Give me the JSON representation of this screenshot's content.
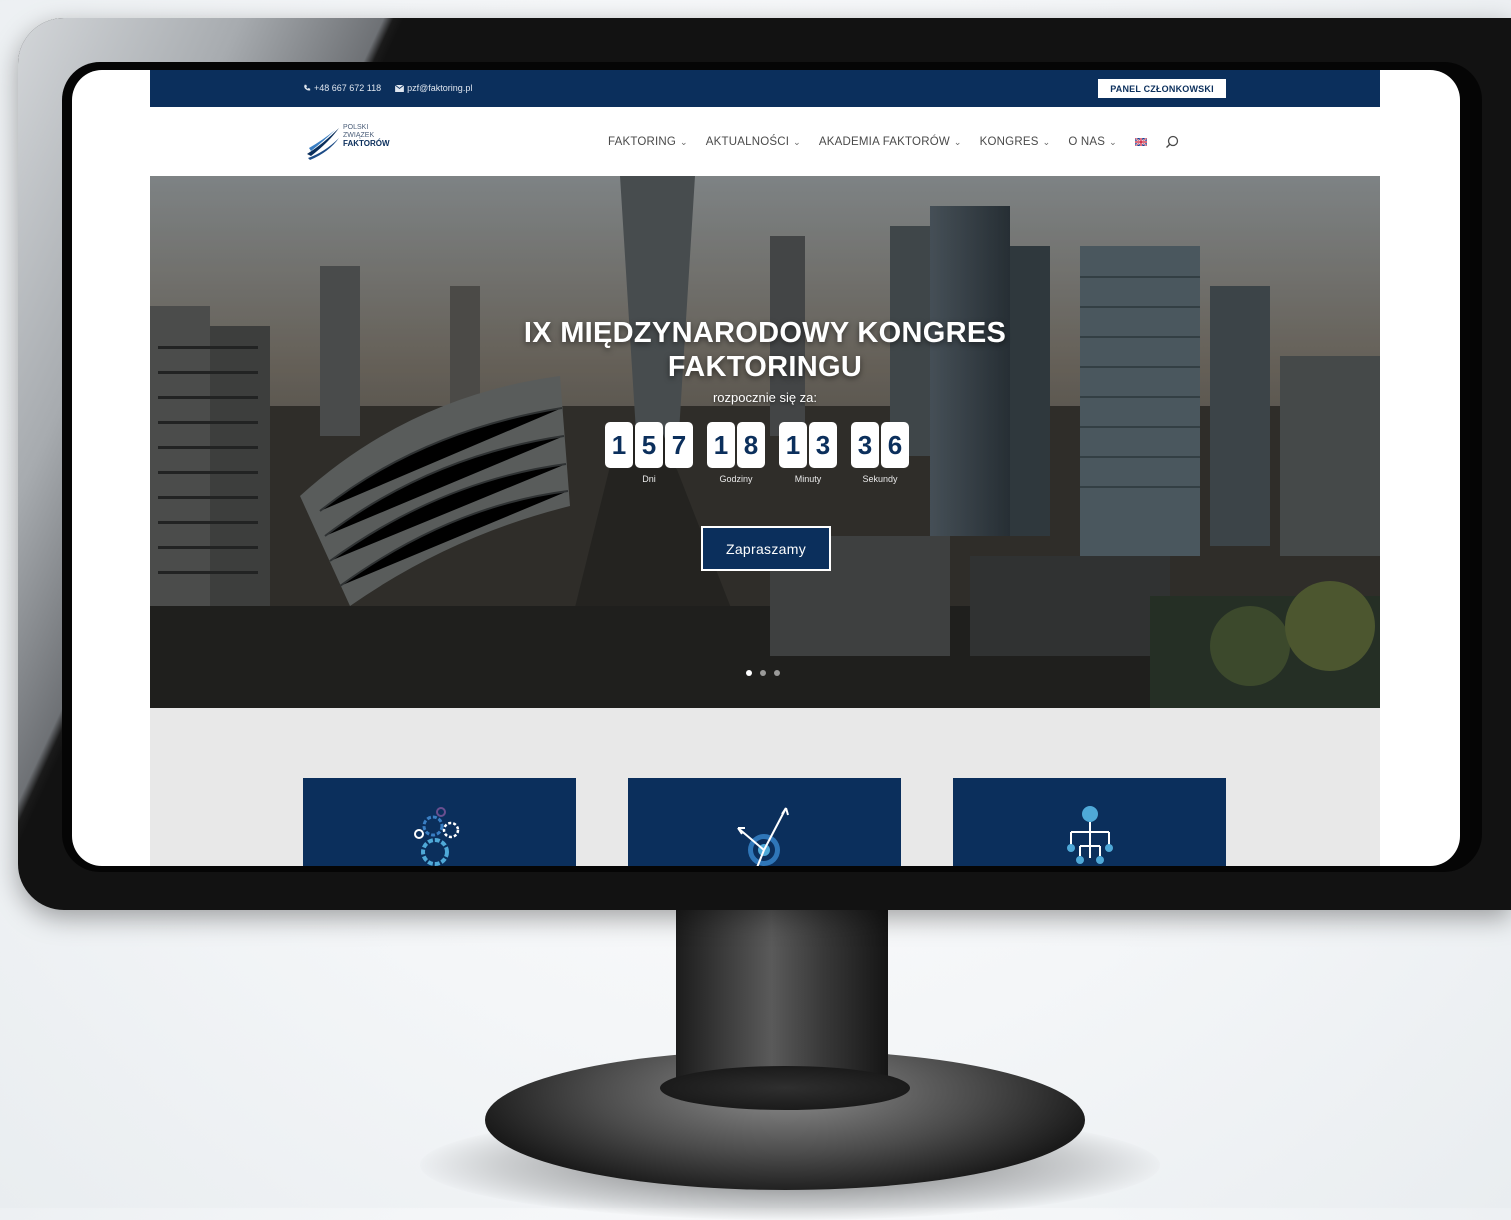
{
  "topbar": {
    "phone": "+48 667 672 118",
    "email": "pzf@faktoring.pl",
    "panel_button": "PANEL CZŁONKOWSKI"
  },
  "logo": {
    "line1": "POLSKI",
    "line2": "ZWIĄZEK",
    "line3": "FAKTORÓW"
  },
  "menu": {
    "items": [
      {
        "label": "FAKTORING"
      },
      {
        "label": "AKTUALNOŚCI"
      },
      {
        "label": "AKADEMIA FAKTORÓW"
      },
      {
        "label": "KONGRES"
      },
      {
        "label": "O NAS"
      }
    ]
  },
  "hero": {
    "title_line1": "IX MIĘDZYNARODOWY KONGRES",
    "title_line2": "FAKTORINGU",
    "subtitle": "rozpocznie się za:",
    "countdown": {
      "days": {
        "d1": "1",
        "d2": "5",
        "d3": "7",
        "label": "Dni"
      },
      "hours": {
        "d1": "1",
        "d2": "8",
        "label": "Godziny"
      },
      "minutes": {
        "d1": "1",
        "d2": "3",
        "label": "Minuty"
      },
      "seconds": {
        "d1": "3",
        "d2": "6",
        "label": "Sekundy"
      }
    },
    "cta": "Zapraszamy"
  },
  "colors": {
    "brand_navy": "#0b2f5c",
    "accent_blue": "#3a7fc4",
    "page_bg": "#e8e8e8"
  }
}
